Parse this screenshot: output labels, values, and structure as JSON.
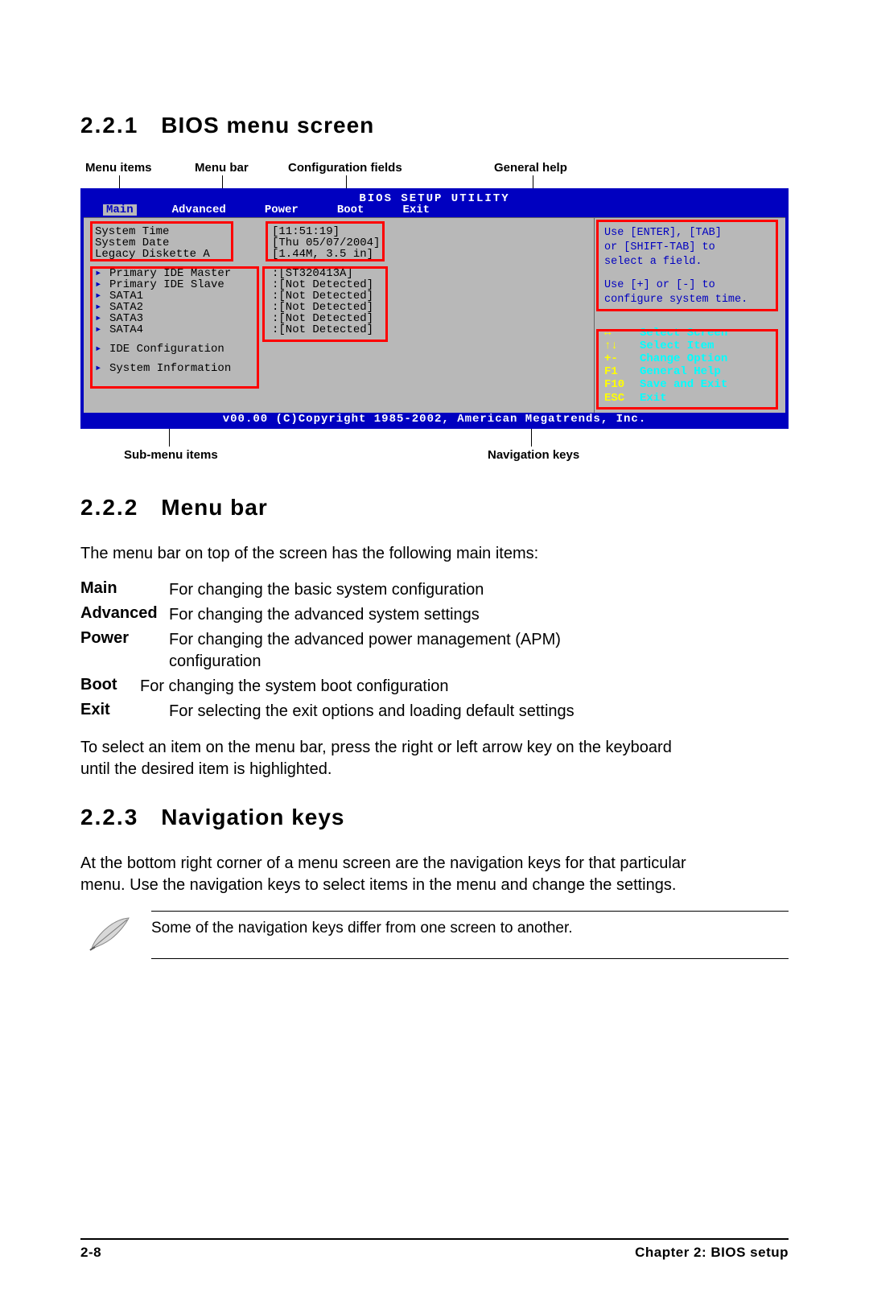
{
  "sections": {
    "s1": {
      "num": "2.2.1",
      "title": "BIOS menu screen"
    },
    "s2": {
      "num": "2.2.2",
      "title": "Menu bar"
    },
    "s3": {
      "num": "2.2.3",
      "title": "Navigation keys"
    }
  },
  "callouts_top": {
    "menu_items": "Menu items",
    "menu_bar": "Menu bar",
    "config_fields": "Configuration fields",
    "general_help": "General help"
  },
  "callouts_bot": {
    "submenu": "Sub-menu items",
    "navkeys": "Navigation keys"
  },
  "bios": {
    "title": "BIOS SETUP UTILITY",
    "tabs": [
      "Main",
      "Advanced",
      "Power",
      "Boot",
      "Exit"
    ],
    "rows_top": [
      {
        "lbl": "System Time",
        "val": "[11:51:19]"
      },
      {
        "lbl": "System Date",
        "val": "[Thu 05/07/2004]"
      },
      {
        "lbl": "Legacy Diskette A",
        "val": "[1.44M, 3.5 in]"
      }
    ],
    "rows_mid": [
      {
        "lbl": "Primary IDE Master",
        "val": ":[ST320413A]"
      },
      {
        "lbl": "Primary IDE Slave",
        "val": ":[Not Detected]"
      },
      {
        "lbl": "SATA1",
        "val": ":[Not Detected]"
      },
      {
        "lbl": "SATA2",
        "val": ":[Not Detected]"
      },
      {
        "lbl": "SATA3",
        "val": ":[Not Detected]"
      },
      {
        "lbl": "SATA4",
        "val": ":[Not Detected]"
      }
    ],
    "rows_bot": [
      {
        "lbl": "IDE Configuration"
      },
      {
        "lbl": "System Information"
      }
    ],
    "help": {
      "l1": "Use [ENTER], [TAB]",
      "l2": "or [SHIFT-TAB] to",
      "l3": "select a field.",
      "l4": "Use [+] or [-] to",
      "l5": "configure system time."
    },
    "nav": [
      {
        "key": "↔",
        "desc": "Select Screen"
      },
      {
        "key": "↑↓",
        "desc": "Select Item"
      },
      {
        "key": "+-",
        "desc": "Change Option"
      },
      {
        "key": "F1",
        "desc": "General Help"
      },
      {
        "key": "F10",
        "desc": "Save and Exit"
      },
      {
        "key": "ESC",
        "desc": "Exit"
      }
    ],
    "footer": "v00.00 (C)Copyright 1985-2002, American Megatrends, Inc."
  },
  "menubar_intro": "The menu bar on top of the screen has the following main items:",
  "menubar_defs": [
    {
      "term": "Main",
      "desc": "For changing the basic system configuration"
    },
    {
      "term": "Advanced",
      "desc": "For changing the advanced system settings"
    },
    {
      "term": "Power",
      "desc": "For changing the advanced power management (APM) configuration"
    },
    {
      "term": "Boot",
      "desc": "For changing the system boot configuration"
    },
    {
      "term": "Exit",
      "desc": "For selecting the exit options and loading default settings"
    }
  ],
  "menubar_outro": "To select an item on the menu bar, press the right or left arrow key on the keyboard until the desired item is highlighted.",
  "navkeys_para": "At the bottom right corner of a menu screen are the navigation keys for that particular menu. Use the navigation keys to select items in the menu and change the settings.",
  "note_text": "Some of the navigation keys differ from one screen to another.",
  "footer": {
    "left": "2-8",
    "right": "Chapter 2: BIOS setup"
  }
}
